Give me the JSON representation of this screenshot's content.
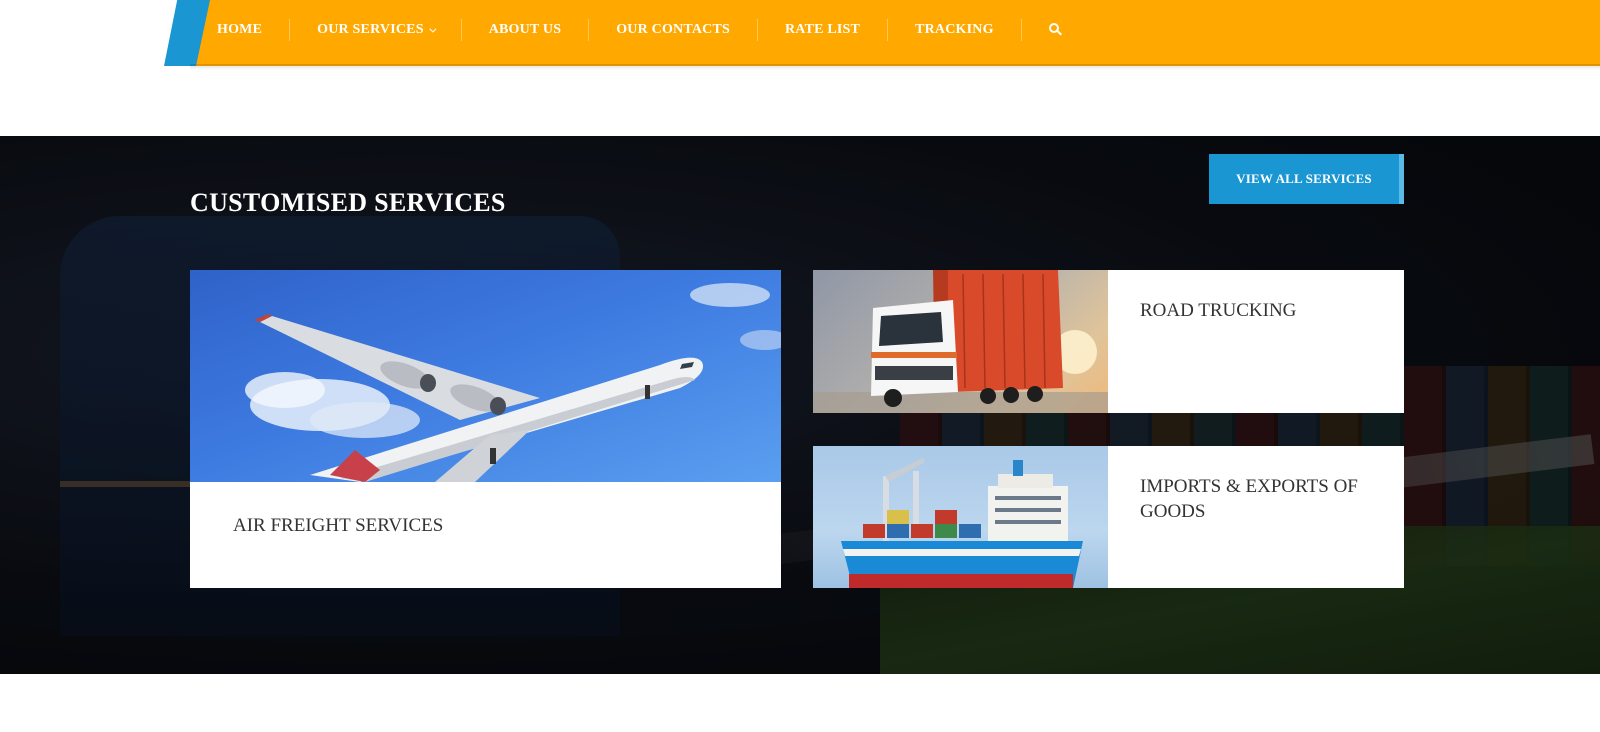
{
  "nav": {
    "items": [
      {
        "label": "HOME"
      },
      {
        "label": "OUR SERVICES",
        "has_dropdown": true
      },
      {
        "label": "ABOUT US"
      },
      {
        "label": "OUR CONTACTS"
      },
      {
        "label": "RATE LIST"
      },
      {
        "label": "TRACKING"
      }
    ],
    "search_icon": "search-icon",
    "colors": {
      "bar": "#ffa800",
      "accent": "#1a96d2"
    }
  },
  "services": {
    "title": "CUSTOMISED SERVICES",
    "view_all_label": "VIEW ALL SERVICES",
    "cards": [
      {
        "label": "AIR FREIGHT SERVICES",
        "image": "airplane-image"
      },
      {
        "label": "ROAD TRUCKING",
        "image": "truck-image"
      },
      {
        "label": "IMPORTS & EXPORTS OF GOODS",
        "image": "cargo-ship-image"
      }
    ]
  }
}
